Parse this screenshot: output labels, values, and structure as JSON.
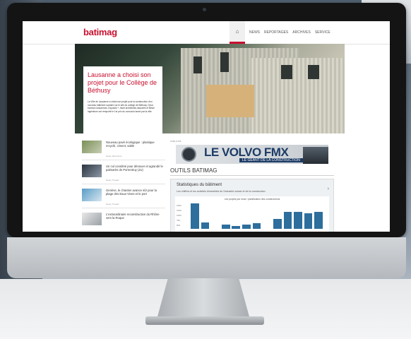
{
  "site": {
    "logo": "batimag",
    "nav": [
      "NEWS",
      "REPORTAGES",
      "ARCHIVES",
      "SERVICE"
    ]
  },
  "hero": {
    "title": "Lausanne a choisi son projet pour le Collège de Béthusy",
    "text": "La Ville de Lausanne a choisi son projet pour la construction d'un nouveau bâtiment scolaire sur le site du collège de Béthusy. Deux bureaux lausannois, Esposito + Javet architectes associés et Bbwh ingénieurs ont remporté le 1er prix du concours lancé par la ville."
  },
  "news": [
    {
      "title": "Nouveau pavé écologique : plastique recyclé, ciment, sable",
      "meta": "News, Économie"
    },
    {
      "title": "Un cul coordiné pour dénouer et agrandir le palmarès de Porrentruy (JU)",
      "meta": "News, Projets"
    },
    {
      "title": "Genève, le chantier avance sûr pour la plage des Eaux-Vives et le port",
      "meta": "News, Projets"
    },
    {
      "title": "L'extraordinaire reconstruction du Rhône vers la Roque",
      "meta": "News, Projets"
    }
  ],
  "ad": {
    "label": "PUBLICITÉ",
    "title": "LE VOLVO FMX",
    "subtitle": "LE GÉANT DE LA CONSTRUCTION"
  },
  "outils": {
    "heading": "OUTILS BATIMAG",
    "stats_title": "Statistiques du bâtiment",
    "stats_subtitle": "Les chiffres et les activités trimestriels de l'industrie suisse et de la construction",
    "chart_title": "Les projets par mois / planification des constructions",
    "ticks": [
      "1500",
      "1250",
      "1000",
      "750",
      "500"
    ]
  },
  "chart_data": {
    "type": "bar",
    "title": "Les projets par mois / planification des constructions",
    "values": [
      1500,
      380,
      0,
      260,
      180,
      260,
      320,
      0,
      600,
      1000,
      1000,
      900,
      1000
    ]
  }
}
